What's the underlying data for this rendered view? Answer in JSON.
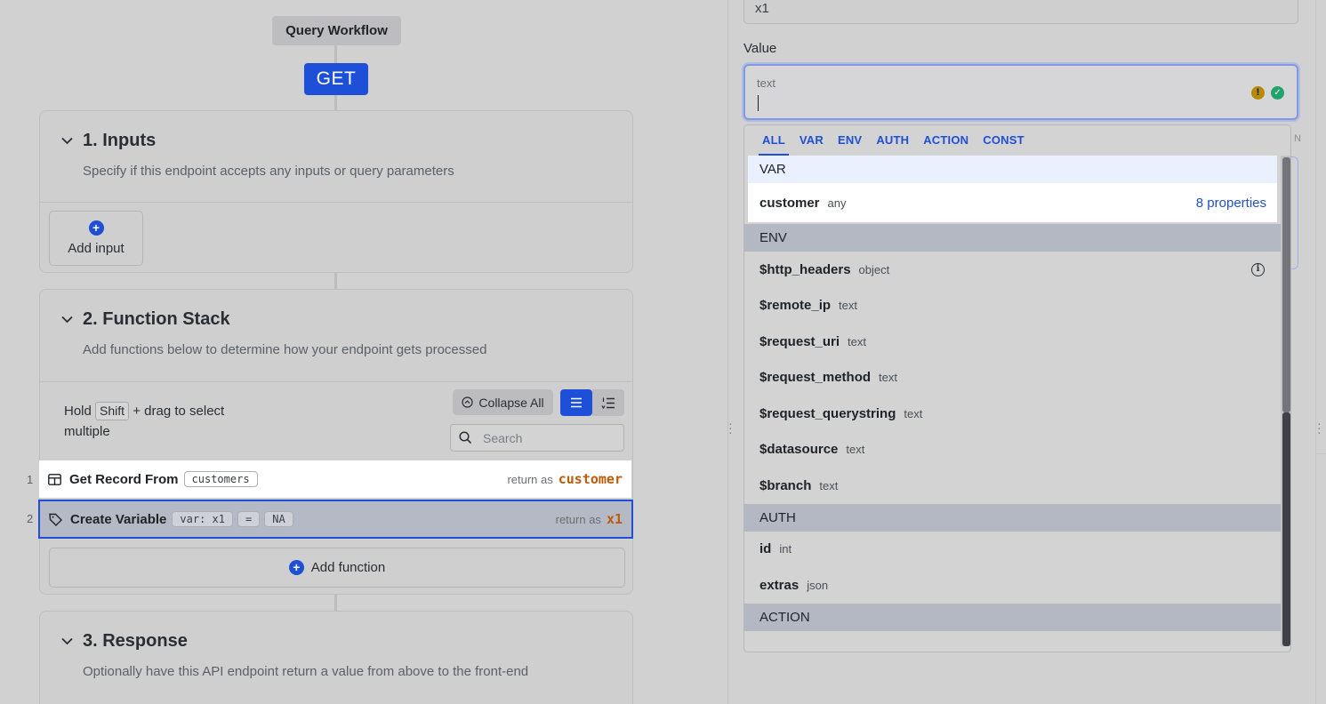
{
  "workflow": {
    "title": "Query Workflow",
    "method": "GET",
    "inputs": {
      "title": "1. Inputs",
      "subtitle": "Specify if this endpoint accepts any inputs or query parameters",
      "add_label": "Add input"
    },
    "function_stack": {
      "title": "2. Function Stack",
      "subtitle": "Add functions below to determine how your endpoint gets processed",
      "hint_hold": "Hold",
      "hint_key": "Shift",
      "hint_rest": "+ drag to select",
      "hint_rest2": "multiple",
      "collapse_label": "Collapse All",
      "search_placeholder": "Search",
      "add_function_label": "Add function",
      "steps": [
        {
          "num": "1",
          "title": "Get Record From",
          "chips": [
            "customers"
          ],
          "return_label": "return as",
          "return_var": "customer"
        },
        {
          "num": "2",
          "title": "Create Variable",
          "chips": [
            "var: x1",
            "=",
            "NA"
          ],
          "return_label": "return as",
          "return_var": "x1"
        }
      ]
    },
    "response": {
      "title": "3. Response",
      "subtitle": "Optionally have this API endpoint return a value from above to the front-end"
    }
  },
  "panel": {
    "top_field_value": "x1",
    "value_label": "Value",
    "value_type": "text",
    "ghost_letter": "N",
    "dropdown": {
      "tabs": [
        "ALL",
        "VAR",
        "ENV",
        "AUTH",
        "ACTION",
        "CONST"
      ],
      "active_tab": "ALL",
      "sections": [
        {
          "label": "VAR",
          "items": [
            {
              "name": "customer",
              "type": "any",
              "extra": "8 properties"
            }
          ]
        },
        {
          "label": "ENV",
          "items": [
            {
              "name": "$http_headers",
              "type": "object",
              "info": true
            },
            {
              "name": "$remote_ip",
              "type": "text"
            },
            {
              "name": "$request_uri",
              "type": "text"
            },
            {
              "name": "$request_method",
              "type": "text"
            },
            {
              "name": "$request_querystring",
              "type": "text"
            },
            {
              "name": "$datasource",
              "type": "text"
            },
            {
              "name": "$branch",
              "type": "text"
            }
          ]
        },
        {
          "label": "AUTH",
          "items": [
            {
              "name": "id",
              "type": "int"
            },
            {
              "name": "extras",
              "type": "json"
            }
          ]
        },
        {
          "label": "ACTION",
          "items": []
        }
      ]
    }
  },
  "colors": {
    "accent": "#1d4fd8",
    "return_var": "#c05a06",
    "warn": "#b68a06",
    "ok": "#22a36a"
  }
}
